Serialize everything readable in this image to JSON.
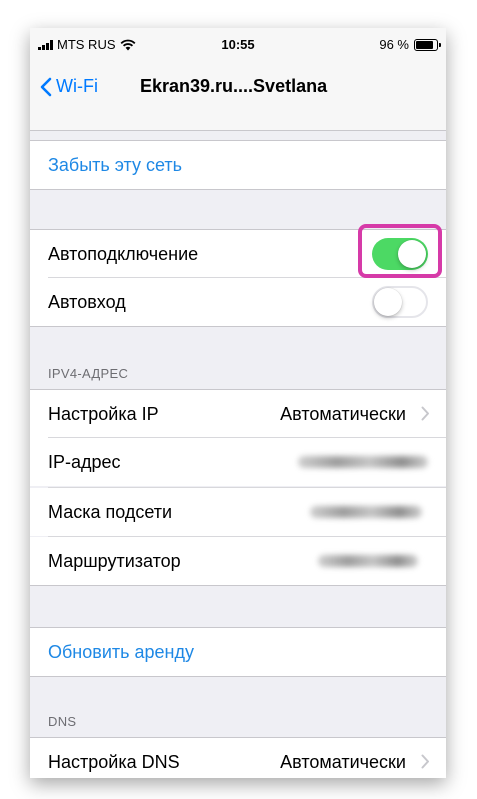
{
  "status_bar": {
    "carrier": "MTS RUS",
    "time": "10:55",
    "battery": "96 %",
    "battery_level": 0.96
  },
  "nav": {
    "back_label": "Wi-Fi",
    "title": "Ekran39.ru....Svetlana"
  },
  "forget_network": "Забыть эту сеть",
  "auto_join": {
    "label": "Автоподключение",
    "on": true
  },
  "auto_login": {
    "label": "Автовход",
    "on": false
  },
  "ipv4": {
    "header": "IPV4-АДРЕС",
    "configure_ip": {
      "label": "Настройка IP",
      "value": "Автоматически"
    },
    "ip_address": {
      "label": "IP-адрес"
    },
    "subnet_mask": {
      "label": "Маска подсети"
    },
    "router": {
      "label": "Маршрутизатор"
    }
  },
  "renew_lease": "Обновить аренду",
  "dns": {
    "header": "DNS",
    "configure_dns": {
      "label": "Настройка DNS",
      "value": "Автоматически"
    }
  },
  "colors": {
    "accent": "#007aff",
    "link": "#1e88e5",
    "toggle_on": "#4cd964",
    "highlight": "#d63aa8",
    "background": "#efeff4"
  }
}
